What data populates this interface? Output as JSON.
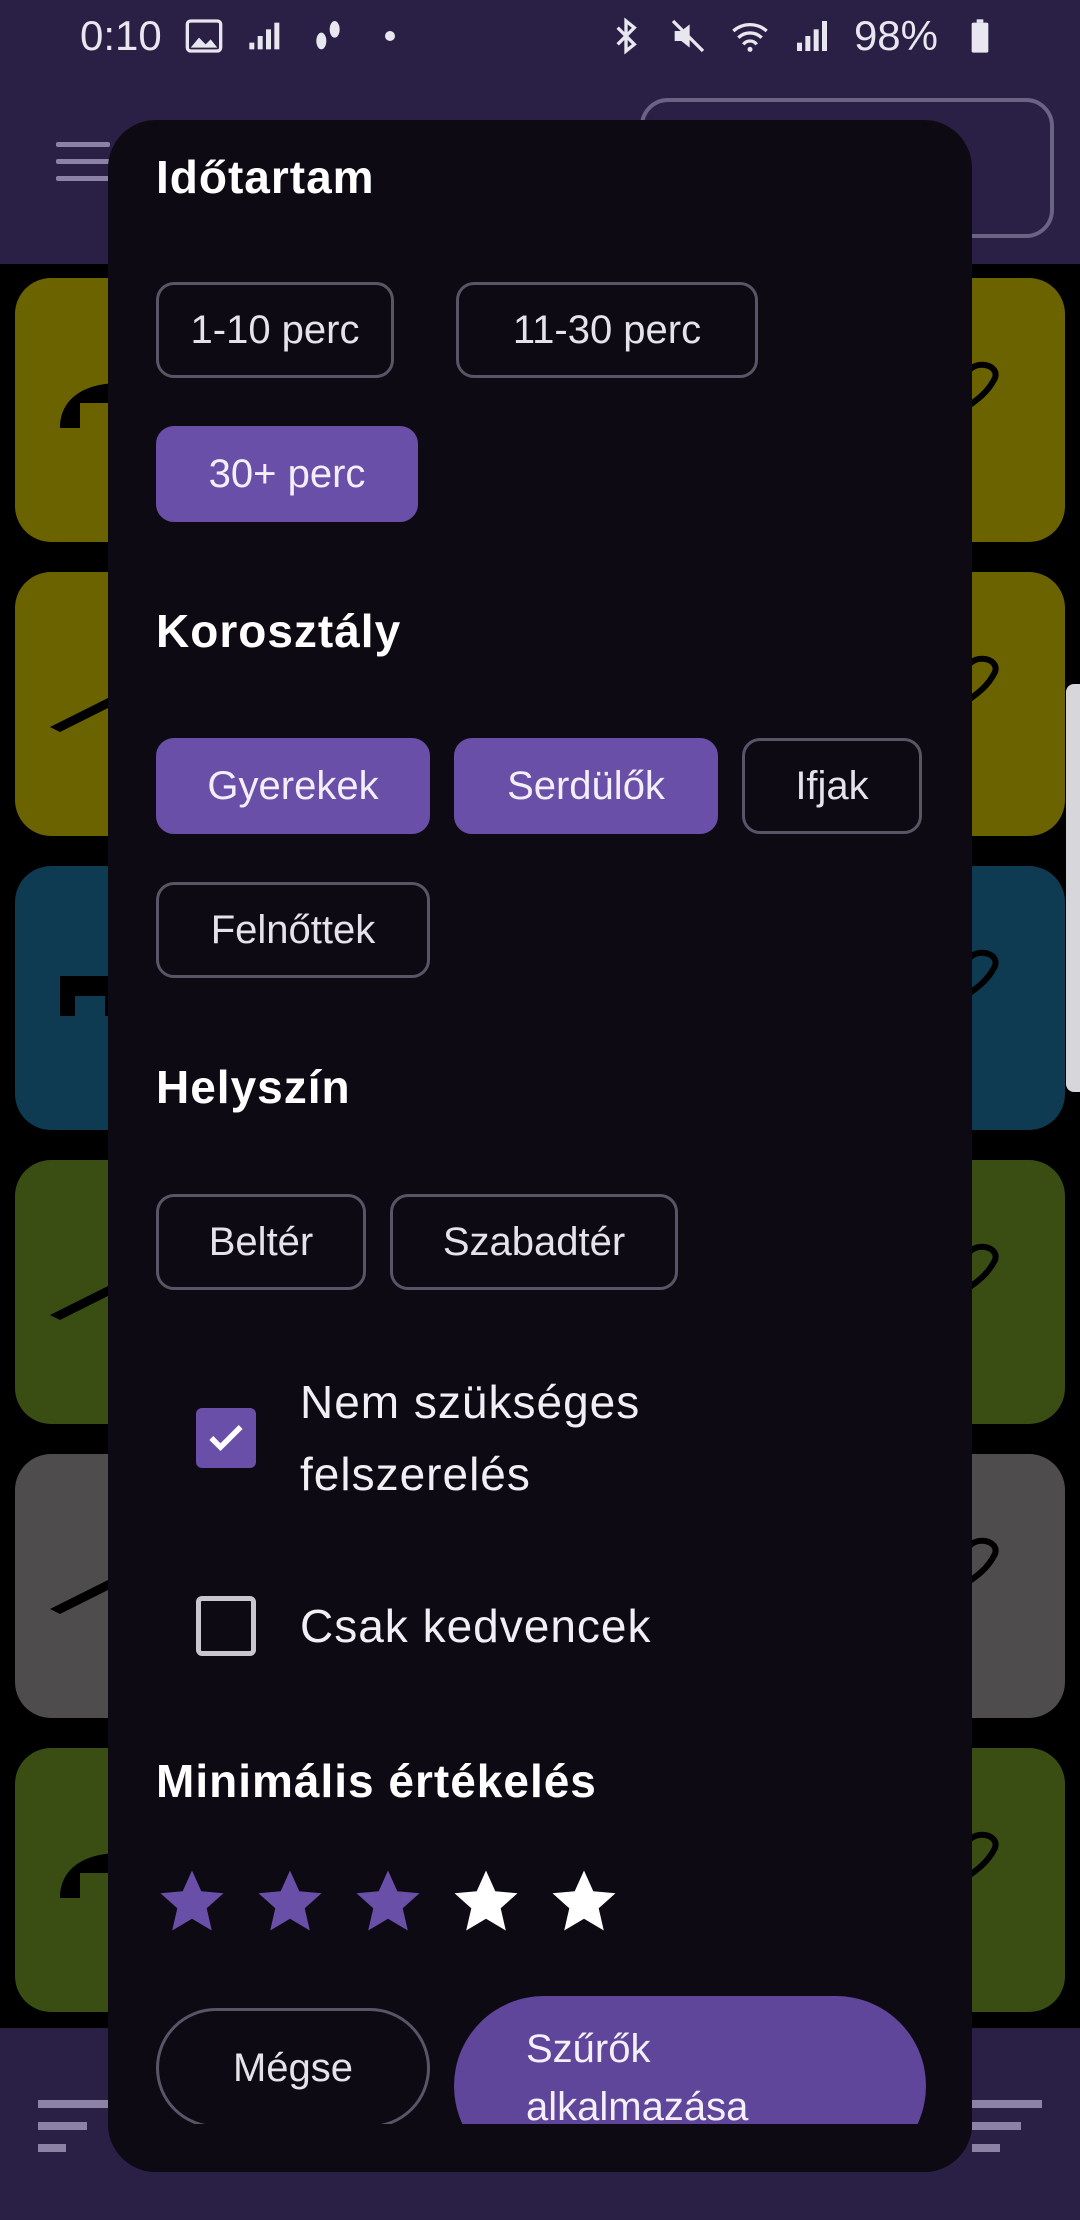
{
  "status_bar": {
    "time": "0:10",
    "battery": "98%",
    "icons_left": [
      "image-icon",
      "equalizer-icon",
      "footsteps-icon",
      "dot-icon"
    ],
    "icons_right": [
      "bluetooth-icon",
      "mute-icon",
      "wifi-icon",
      "signal-icon",
      "battery-icon"
    ]
  },
  "colors": {
    "accent": "#6a4fa8",
    "apply_button": "#5f469b",
    "dialog_bg": "#0d0a13",
    "app_bar": "#2a1f45",
    "tile_yellow": "#6b6200",
    "tile_blue": "#0e3a52",
    "tile_green": "#3a4e14",
    "tile_gray": "#4e4c4c"
  },
  "filters": {
    "duration": {
      "heading": "Időtartam",
      "options": [
        {
          "label": "1-10 perc",
          "selected": false
        },
        {
          "label": "11-30 perc",
          "selected": false
        },
        {
          "label": "30+ perc",
          "selected": true
        }
      ]
    },
    "age_group": {
      "heading": "Korosztály",
      "options": [
        {
          "label": "Gyerekek",
          "selected": true
        },
        {
          "label": "Serdülők",
          "selected": true
        },
        {
          "label": "Ifjak",
          "selected": false
        },
        {
          "label": "Felnőttek",
          "selected": false
        }
      ]
    },
    "location": {
      "heading": "Helyszín",
      "options": [
        {
          "label": "Beltér",
          "selected": false
        },
        {
          "label": "Szabadtér",
          "selected": false
        }
      ]
    },
    "no_equipment": {
      "line1": "Nem szükséges",
      "line2": "felszerelés",
      "checked": true
    },
    "favorites_only": {
      "label": "Csak kedvencek",
      "checked": false
    },
    "rating": {
      "heading": "Minimális értékelés",
      "value": 3,
      "max": 5
    }
  },
  "actions": {
    "cancel": "Mégse",
    "apply_line1": "Szűrők",
    "apply_line2": "alkalmazása"
  }
}
